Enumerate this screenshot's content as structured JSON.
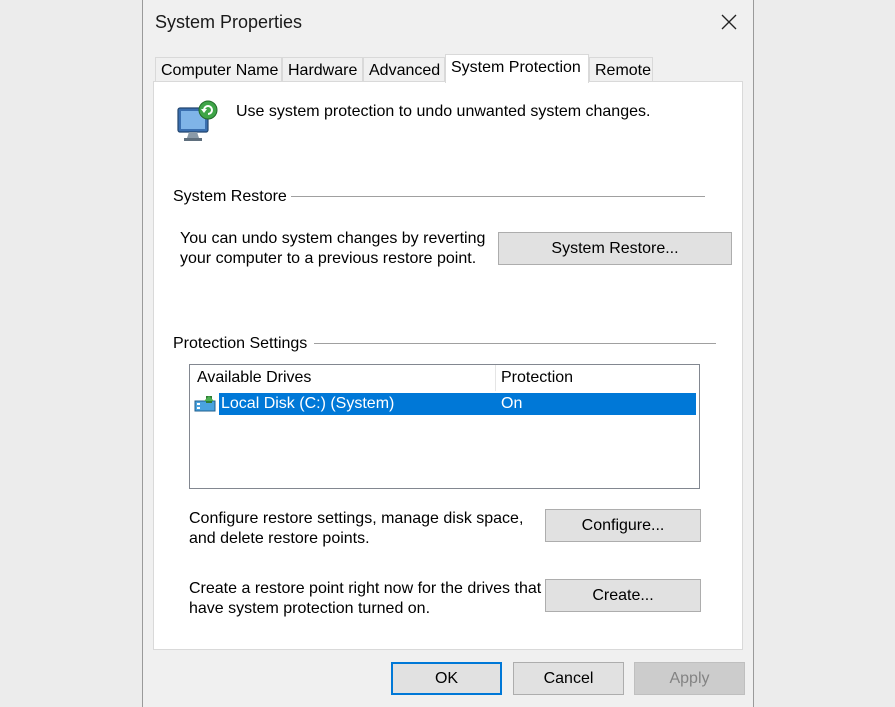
{
  "window": {
    "title": "System Properties"
  },
  "tabs": [
    {
      "label": "Computer Name",
      "active": false
    },
    {
      "label": "Hardware",
      "active": false
    },
    {
      "label": "Advanced",
      "active": false
    },
    {
      "label": "System Protection",
      "active": true
    },
    {
      "label": "Remote",
      "active": false
    }
  ],
  "intro": {
    "text": "Use system protection to undo unwanted system changes.",
    "icon": "system-protection-monitor-icon"
  },
  "system_restore": {
    "group_label": "System Restore",
    "description_line1": "You can undo system changes by reverting",
    "description_line2": "your computer to a previous restore point.",
    "button_label": "System Restore..."
  },
  "protection_settings": {
    "group_label": "Protection Settings",
    "columns": [
      "Available Drives",
      "Protection"
    ],
    "drives": [
      {
        "name": "Local Disk (C:) (System)",
        "protection": "On",
        "selected": true,
        "icon": "drive-icon"
      }
    ],
    "configure_text_line1": "Configure restore settings, manage disk space,",
    "configure_text_line2": "and delete restore points.",
    "configure_button": "Configure...",
    "create_text_line1": "Create a restore point right now for the drives that",
    "create_text_line2": "have system protection turned on.",
    "create_button": "Create..."
  },
  "footer": {
    "ok_label": "OK",
    "cancel_label": "Cancel",
    "apply_label": "Apply"
  },
  "colors": {
    "selection": "#0078d7",
    "dialog_bg": "#f0f0f0",
    "panel_bg": "#ffffff"
  }
}
